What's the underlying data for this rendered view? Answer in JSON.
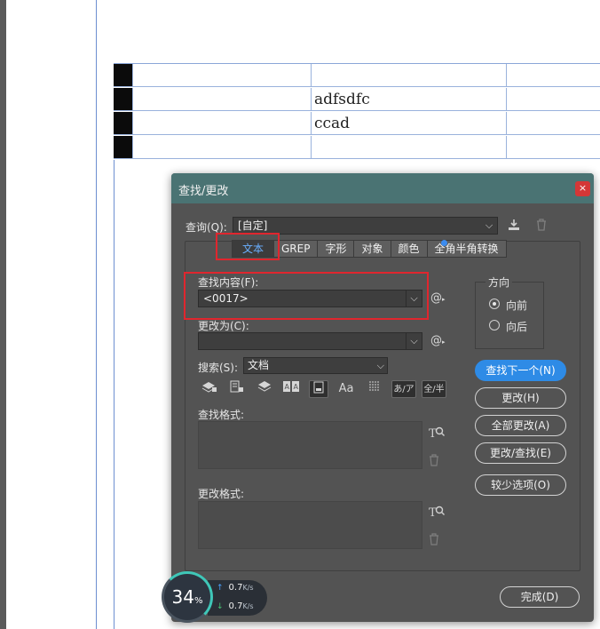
{
  "document": {
    "cells": [
      [
        "",
        "",
        ""
      ],
      [
        "",
        "adfsdfc",
        ""
      ],
      [
        "",
        "ccad",
        ""
      ],
      [
        "",
        "",
        ""
      ]
    ]
  },
  "dialog": {
    "title": "查找/更改",
    "close_label": "×",
    "query": {
      "label": "查询(Q):",
      "value": "[自定]"
    },
    "tabs": [
      "文本",
      "GREP",
      "字形",
      "对象",
      "颜色",
      "全角半角转换"
    ],
    "active_tab": "文本",
    "find_what": {
      "label": "查找内容(F):",
      "value": "<0017>"
    },
    "change_to": {
      "label": "更改为(C):",
      "value": ""
    },
    "search": {
      "label": "搜索(S):",
      "value": "文档"
    },
    "option_icons": [
      "lock-layers-icon",
      "lock-stories-icon",
      "hidden-layers-icon",
      "master-pages-icon",
      "footnotes-icon",
      "case-sensitive-icon",
      "whole-word-icon",
      "kana-sensitive-icon",
      "width-sensitive-icon"
    ],
    "option_glyphs": {
      "case": "Aa",
      "kana": "あ/ア",
      "width": "全/半"
    },
    "find_format_label": "查找格式:",
    "change_format_label": "更改格式:",
    "direction": {
      "title": "方向",
      "forward": "向前",
      "backward": "向后",
      "selected": "forward"
    },
    "buttons": {
      "find_next": "查找下一个(N)",
      "change": "更改(H)",
      "change_all": "全部更改(A)",
      "change_find": "更改/查找(E)",
      "fewer_options": "较少选项(O)",
      "done": "完成(D)"
    },
    "colors": {
      "titlebar": "#4a7373",
      "panel": "#535353",
      "primary": "#2e8be6",
      "highlight": "#e0262e"
    }
  },
  "network_widget": {
    "cpu_percent": "34",
    "percent_sign": "%",
    "upload": "0.7",
    "download": "0.7",
    "unit": "K/s"
  }
}
